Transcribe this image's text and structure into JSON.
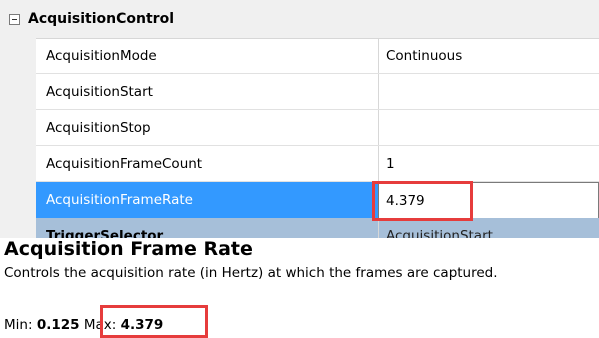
{
  "category": {
    "label": "AcquisitionControl",
    "expanded": true
  },
  "rows": [
    {
      "name": "AcquisitionMode",
      "value": "Continuous"
    },
    {
      "name": "AcquisitionStart",
      "value": ""
    },
    {
      "name": "AcquisitionStop",
      "value": ""
    },
    {
      "name": "AcquisitionFrameCount",
      "value": "1"
    },
    {
      "name": "AcquisitionFrameRate",
      "value": "4.379",
      "selected": true
    },
    {
      "name": "TriggerSelector",
      "value": "AcquisitionStart"
    }
  ],
  "help": {
    "title": "Acquisition Frame Rate",
    "description": "Controls the acquisition rate (in Hertz) at which the frames are captured.",
    "min_label": "Min:",
    "min_value": "0.125",
    "max_label": "Max:",
    "max_value": "4.379"
  },
  "colors": {
    "selection": "#3399ff",
    "highlight_box": "#e63c3c",
    "gutter": "#f0f0f0"
  }
}
